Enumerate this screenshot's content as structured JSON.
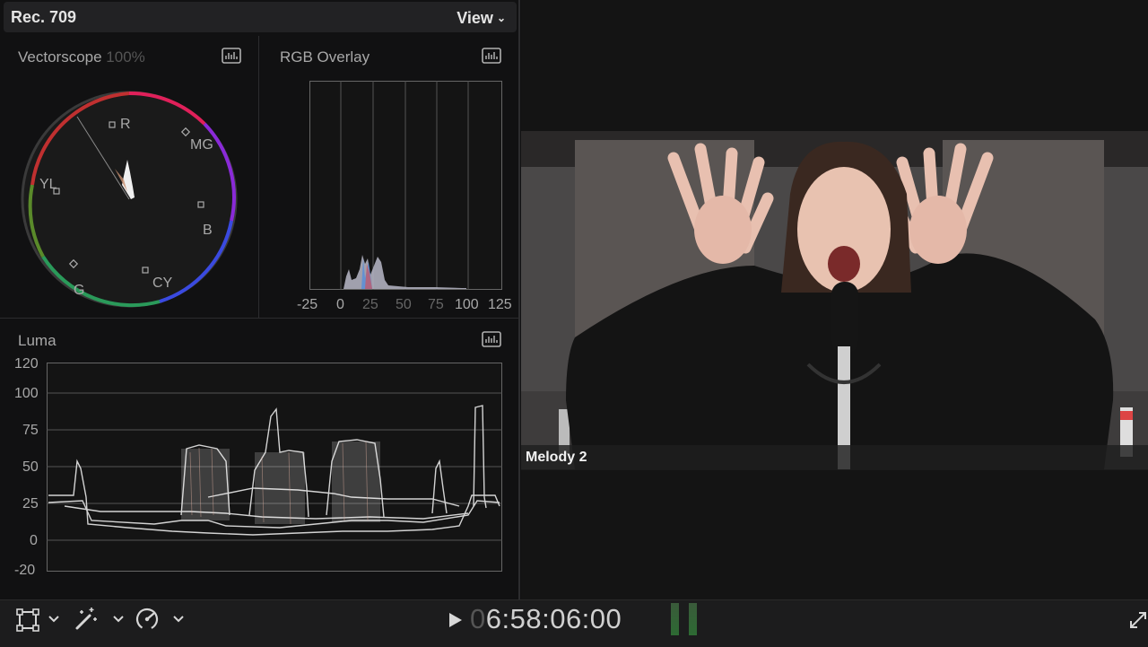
{
  "scopes_header": {
    "color_space": "Rec. 709",
    "view_menu": "View"
  },
  "vectorscope": {
    "title": "Vectorscope",
    "zoom": "100%",
    "targets": {
      "r": "R",
      "mg": "MG",
      "b": "B",
      "cy": "CY",
      "g": "G",
      "yl": "YL"
    }
  },
  "rgb_overlay": {
    "title": "RGB Overlay",
    "x_ticks": [
      "-25",
      "0",
      "25",
      "50",
      "75",
      "100",
      "125"
    ]
  },
  "luma": {
    "title": "Luma",
    "y_ticks": [
      "120",
      "100",
      "75",
      "50",
      "25",
      "0",
      "-20"
    ]
  },
  "viewer": {
    "clip_name": "Melody 2"
  },
  "transport": {
    "timecode_lead": "0",
    "timecode": "6:58:06:00"
  },
  "icons": {
    "transform": "crop-transform-icon",
    "enhance": "magic-wand-icon",
    "speed": "speedometer-icon",
    "fullscreen": "fullscreen-icon"
  }
}
